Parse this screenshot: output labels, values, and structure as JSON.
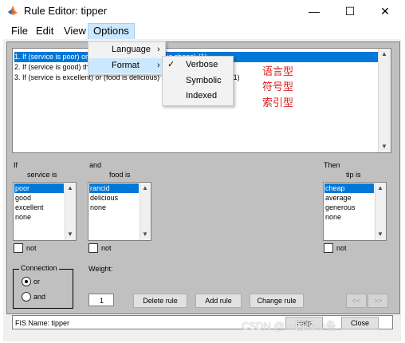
{
  "window": {
    "title": "Rule Editor: tipper",
    "minimize_glyph": "—",
    "maximize_glyph": "☐",
    "close_glyph": "✕"
  },
  "menubar": {
    "items": [
      "File",
      "Edit",
      "View",
      "Options"
    ],
    "active": "Options"
  },
  "rules": [
    "1. If (service is poor) or (food is rancid) then (tip is cheap) (1)",
    "2. If (service is good) then (tip is average) (1)",
    "3. If (service is excellent) or (food is delicious) then (tip is generous) (1)"
  ],
  "options_menu": {
    "items": [
      {
        "label": "Language",
        "submenu_arrow": "›"
      },
      {
        "label": "Format",
        "submenu_arrow": "›"
      }
    ],
    "format_submenu": [
      {
        "label": "Verbose",
        "checked": true,
        "check": "✓"
      },
      {
        "label": "Symbolic",
        "checked": false
      },
      {
        "label": "Indexed",
        "checked": false
      }
    ]
  },
  "annotations": [
    "语言型",
    "符号型",
    "索引型"
  ],
  "if_section": {
    "if_label": "If",
    "var_label": "service is",
    "items": [
      "poor",
      "good",
      "excellent",
      "none"
    ],
    "selected": "poor",
    "not_label": "not"
  },
  "and_section": {
    "and_label": "and",
    "var_label": "food is",
    "items": [
      "rancid",
      "delicious",
      "none"
    ],
    "selected": "rancid",
    "not_label": "not"
  },
  "then_section": {
    "then_label": "Then",
    "var_label": "tip is",
    "items": [
      "cheap",
      "average",
      "generous",
      "none"
    ],
    "selected": "cheap",
    "not_label": "not"
  },
  "connection": {
    "label": "Connection",
    "options": [
      "or",
      "and"
    ],
    "selected": "or"
  },
  "weight": {
    "label": "Weight:",
    "value": "1"
  },
  "buttons": {
    "delete": "Delete rule",
    "add": "Add rule",
    "change": "Change rule",
    "prev": "<<",
    "next": ">>"
  },
  "status": {
    "text": "FIS Name: tipper",
    "help": "Help",
    "close": "Close"
  },
  "watermark": "CSDN @一菌城小备",
  "colors": {
    "selection": "#0078d7",
    "panel": "#c0c0c0",
    "annotation": "#e02020",
    "menu_active": "#cce8ff"
  },
  "icons": [
    "matlab-icon",
    "check-icon",
    "chevron-right-icon",
    "scroll-up-icon",
    "scroll-down-icon"
  ]
}
